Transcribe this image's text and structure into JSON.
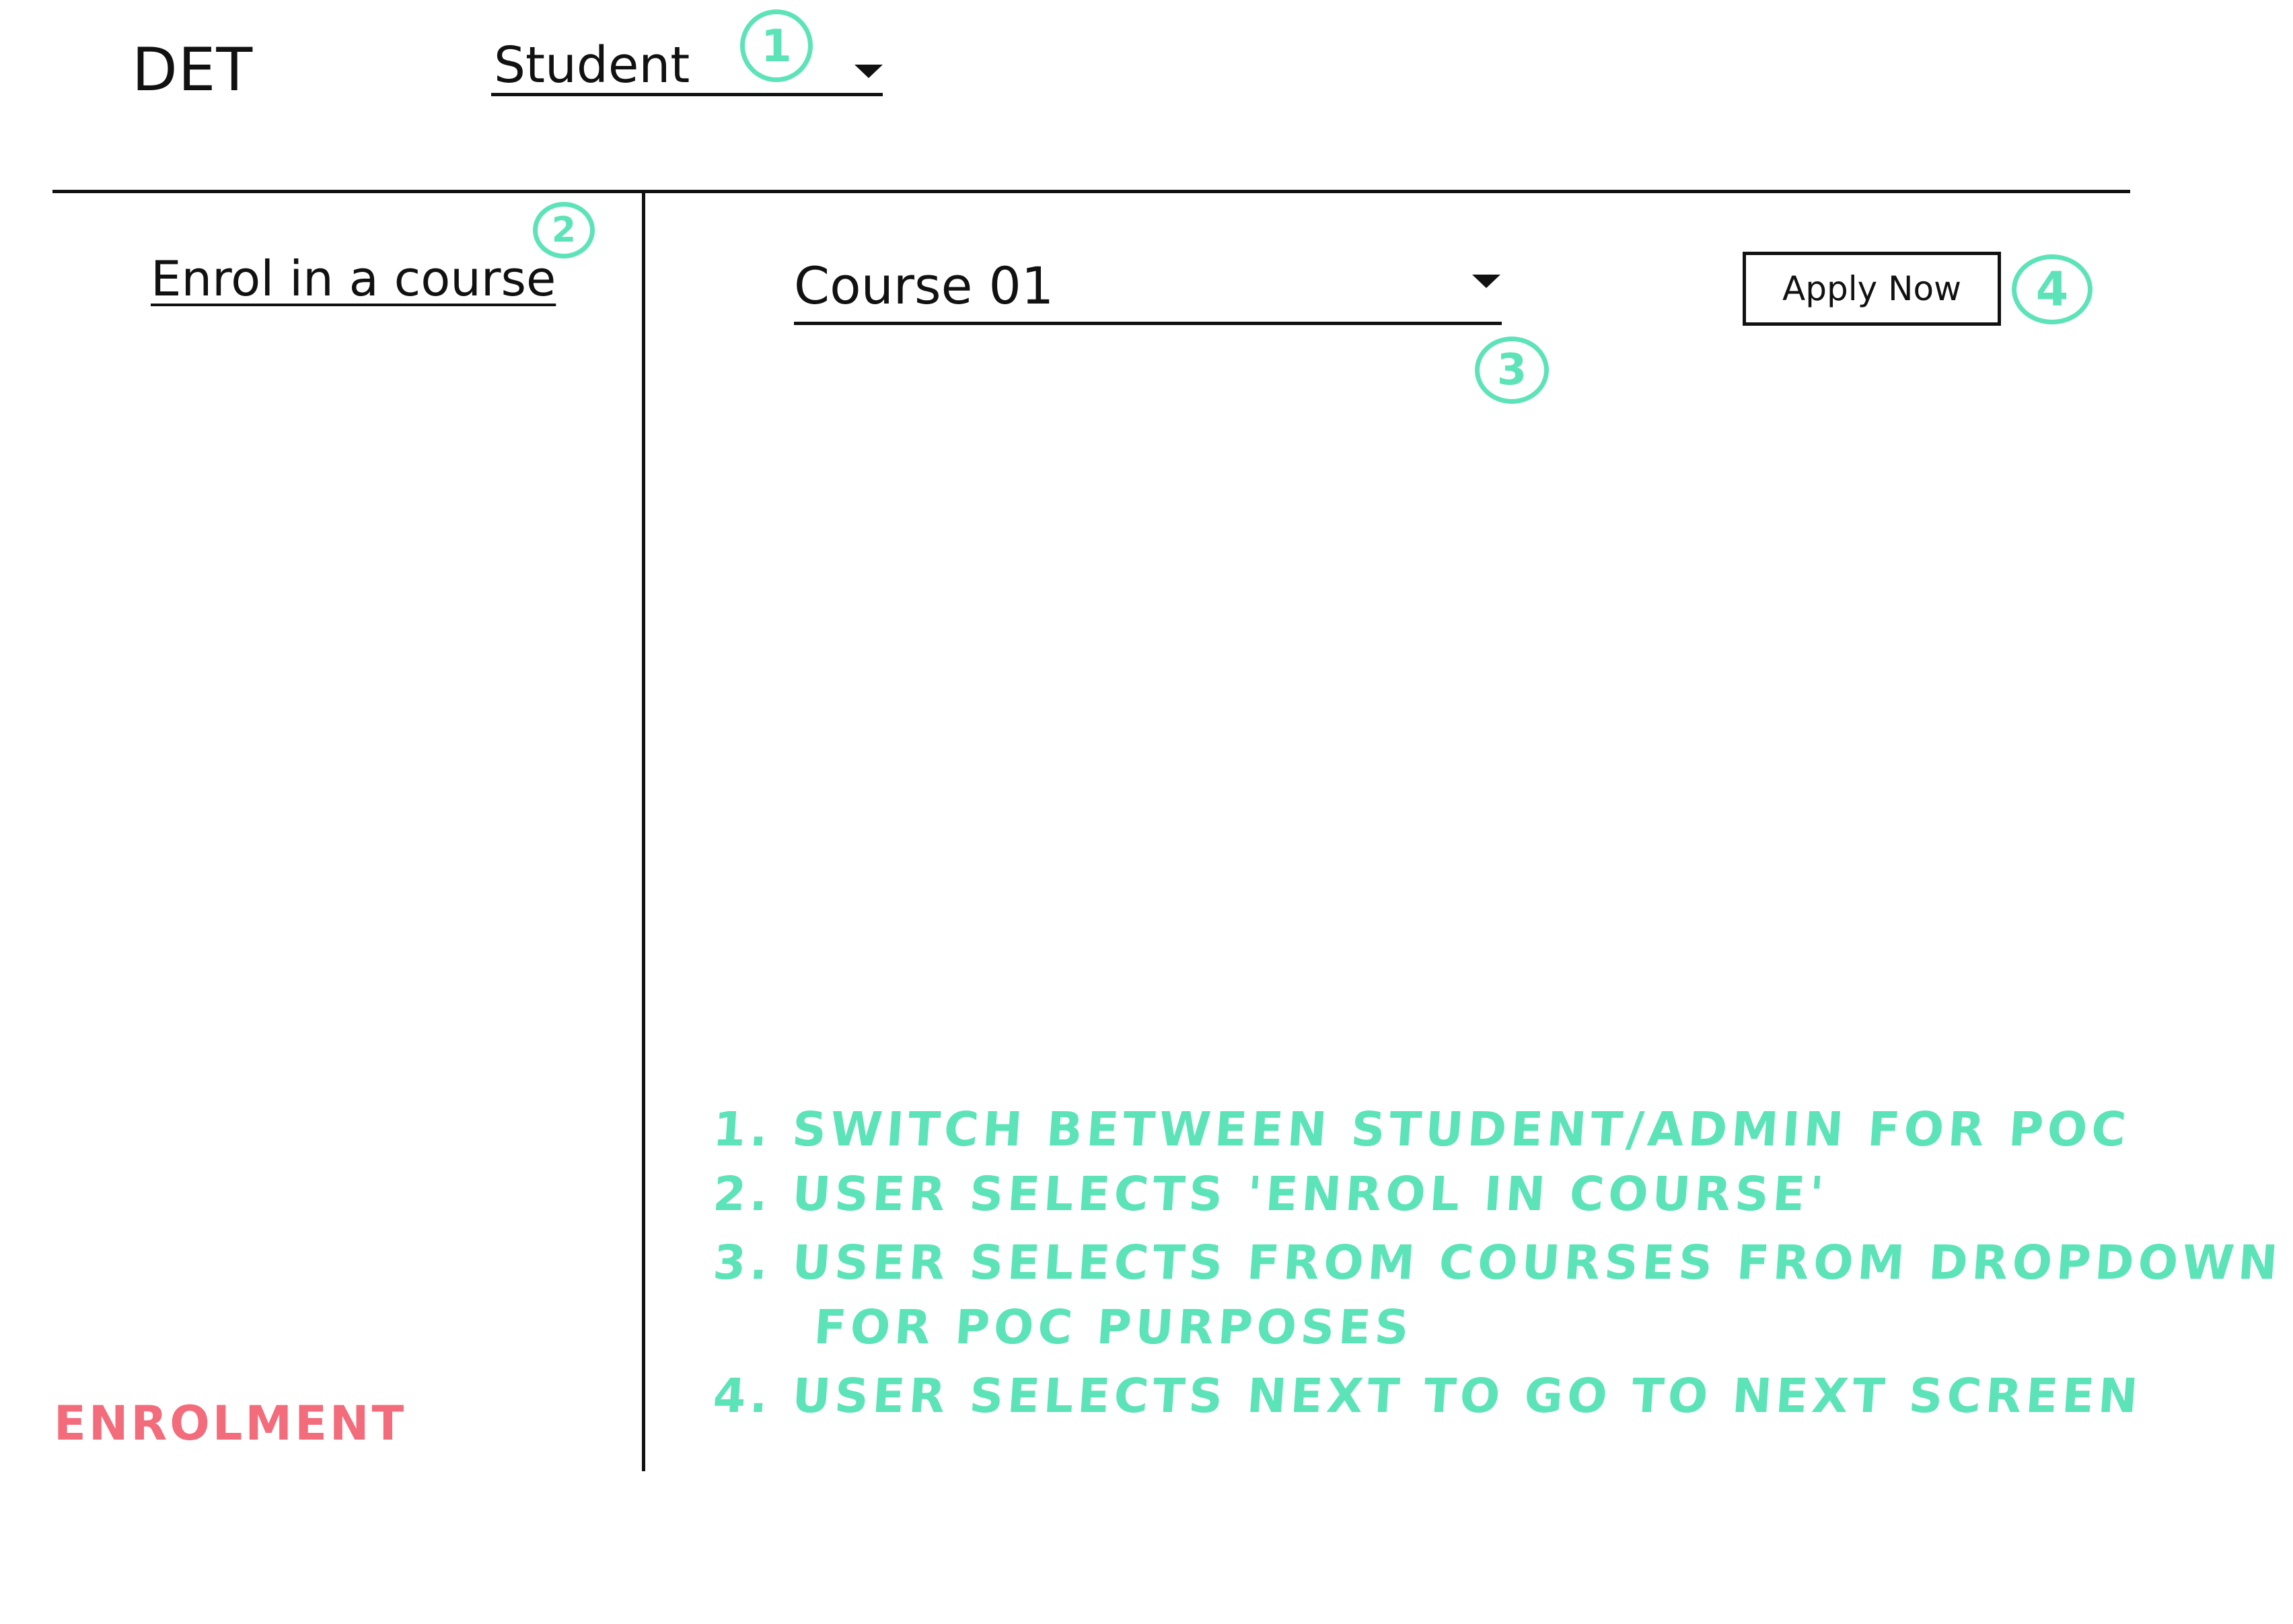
{
  "header": {
    "brand": "DET",
    "role_select": {
      "value": "Student"
    }
  },
  "sidebar": {
    "items": [
      {
        "label": "Enrol in a course"
      }
    ]
  },
  "main": {
    "course_select": {
      "value": "Course 01"
    },
    "apply_button": "Apply Now"
  },
  "annotations": {
    "markers": [
      "1",
      "2",
      "3",
      "4"
    ],
    "notes": [
      "1. SWITCH BETWEEN STUDENT/ADMIN FOR POC",
      "2. USER SELECTS 'ENROL IN COURSE'",
      "3. USER SELECTS FROM COURSES FROM DROPDOWN",
      "FOR POC PURPOSES",
      "4. USER SELECTS NEXT TO GO TO NEXT SCREEN"
    ],
    "section_tag": "ENROLMENT"
  },
  "colors": {
    "annotation": "#5de3b8",
    "section_tag": "#f36c7b",
    "ink": "#111111"
  }
}
